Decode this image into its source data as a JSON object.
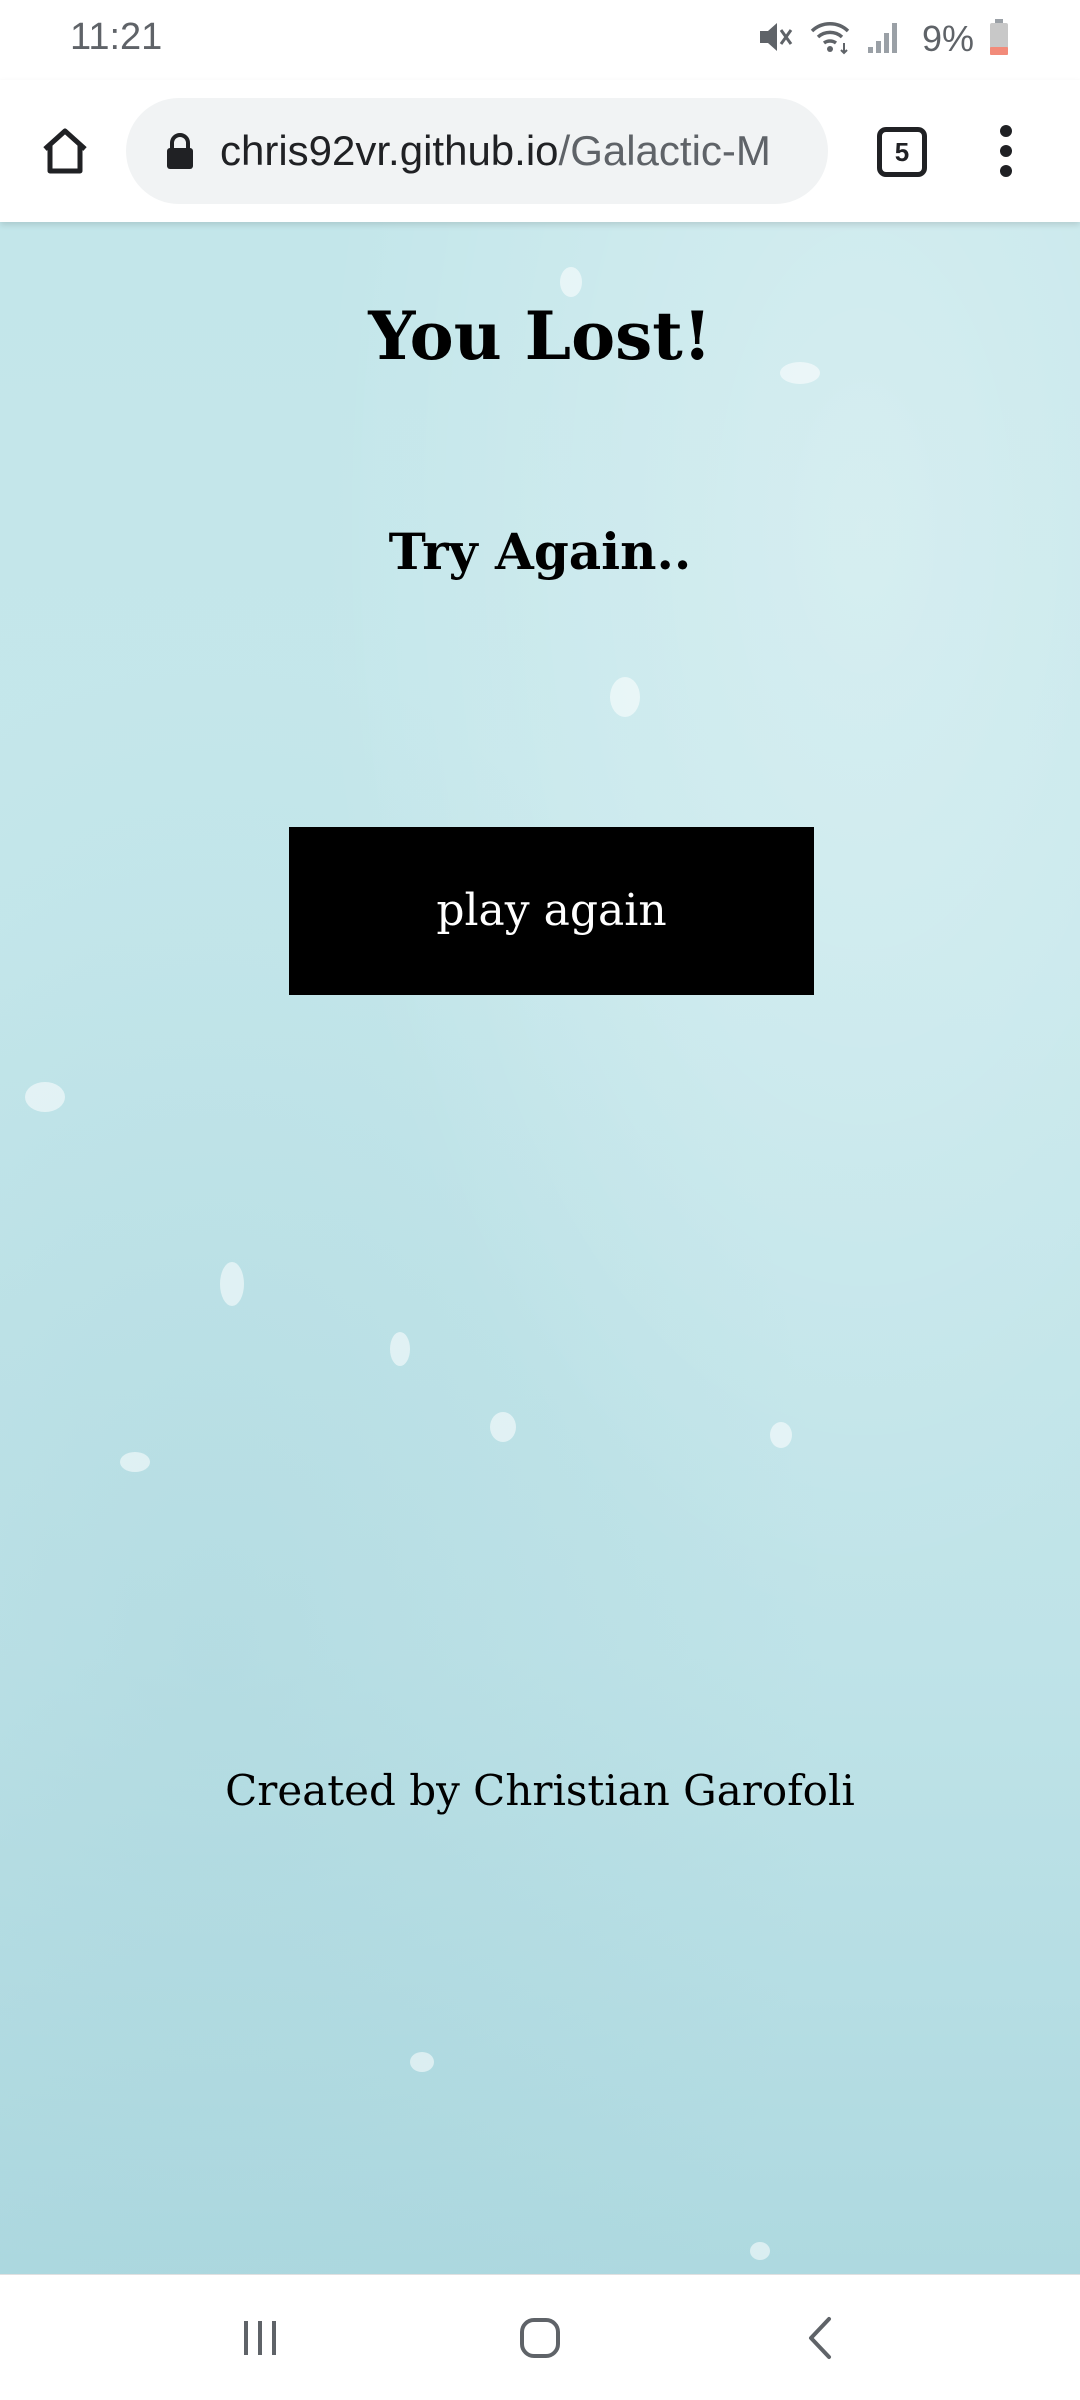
{
  "status_bar": {
    "time": "11:21",
    "battery_percent": "9%",
    "icons": [
      "mute-icon",
      "wifi-icon",
      "signal-icon",
      "battery-icon"
    ]
  },
  "browser": {
    "url_domain": "chris92vr.github.io",
    "url_path": "/Galactic-M",
    "tab_count": "5",
    "icons": [
      "home-icon",
      "lock-icon",
      "tabs-icon",
      "more-vert-icon"
    ]
  },
  "game": {
    "title": "You Lost!",
    "subtitle": "Try Again..",
    "play_button_label": "play again",
    "credit": "Created by Christian Garofoli"
  },
  "nav_bar": {
    "icons": [
      "recent-apps-icon",
      "home-nav-icon",
      "back-icon"
    ]
  },
  "colors": {
    "page_background": "#c3e6ea",
    "button_background": "#000000",
    "button_text": "#ffffff",
    "text": "#000000"
  }
}
